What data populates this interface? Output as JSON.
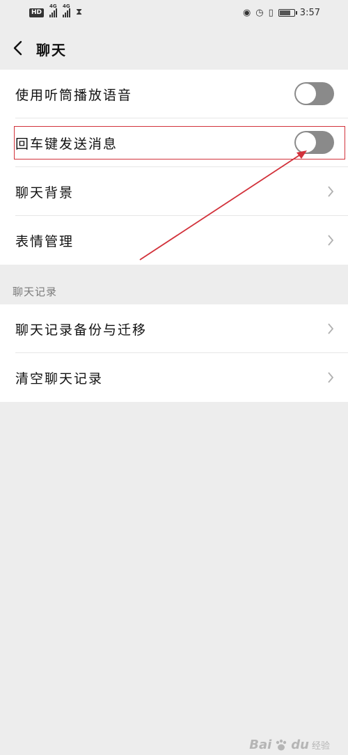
{
  "status_bar": {
    "hd_label": "HD",
    "sim1_label": "4G",
    "sim2_label": "4G",
    "time": "3:57",
    "hourglass_glyph": "⧗",
    "eye_glyph": "◉",
    "alarm_glyph": "◷",
    "vibrate_glyph": "▯"
  },
  "nav": {
    "title": "聊天"
  },
  "settings": {
    "items": [
      {
        "label": "使用听筒播放语音",
        "control": "toggle",
        "checked": false
      },
      {
        "label": "回车键发送消息",
        "control": "toggle",
        "checked": false
      },
      {
        "label": "聊天背景",
        "control": "chevron"
      },
      {
        "label": "表情管理",
        "control": "chevron"
      }
    ]
  },
  "chat_history": {
    "section_title": "聊天记录",
    "items": [
      {
        "label": "聊天记录备份与迁移",
        "control": "chevron"
      },
      {
        "label": "清空聊天记录",
        "control": "chevron"
      }
    ]
  },
  "watermark": {
    "logo": "Bai",
    "logo_suffix": "du",
    "text": "经验"
  },
  "colors": {
    "background": "#ededed",
    "card": "#ffffff",
    "toggle_off": "#8a8a8a",
    "annotation": "#d2313a"
  }
}
